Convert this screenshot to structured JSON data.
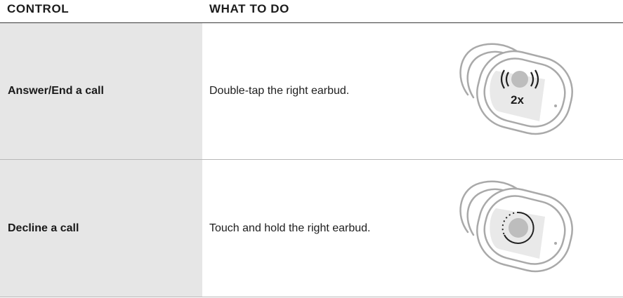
{
  "table": {
    "headers": {
      "control": "CONTROL",
      "what_to_do": "WHAT TO DO"
    },
    "rows": [
      {
        "control": "Answer/End a call",
        "action": "Double-tap the right earbud.",
        "illustration": {
          "icon": "earbud-double-tap-icon",
          "tap_count_label": "2x"
        }
      },
      {
        "control": "Decline a call",
        "action": "Touch and hold the right earbud.",
        "illustration": {
          "icon": "earbud-touch-hold-icon"
        }
      }
    ]
  },
  "colors": {
    "control_column_background": "#e6e6e6",
    "header_rule": "#3a3a3a",
    "row_rule": "#b8b8b8",
    "earbud_outline": "#a9a9a9",
    "touch_surface": "#e9e9e9",
    "touch_dot": "#bdbdbd"
  }
}
